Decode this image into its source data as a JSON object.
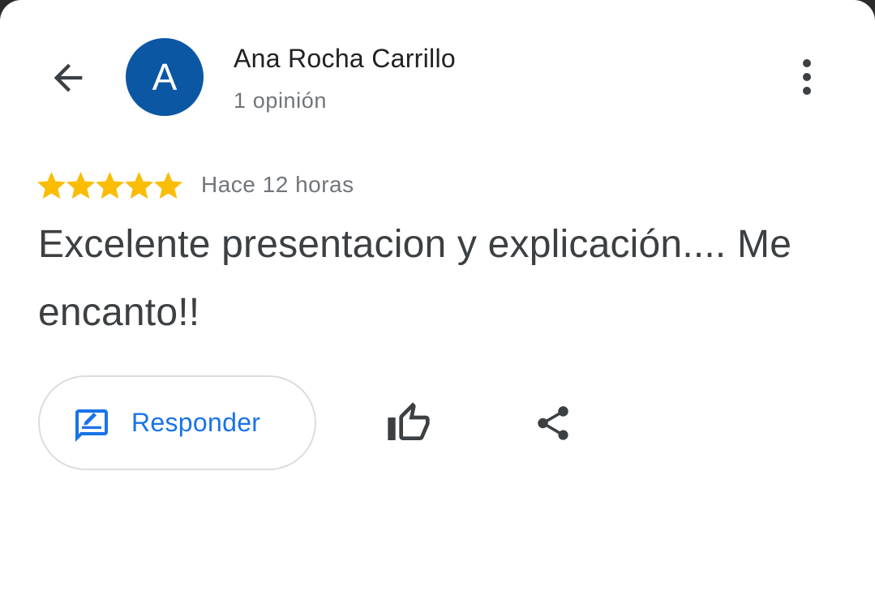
{
  "header": {
    "avatar_letter": "A",
    "avatar_color": "#0b57a4",
    "author_name": "Ana Rocha Carrillo",
    "review_count": "1 opinión",
    "back_icon": "arrow-back-icon",
    "more_icon": "more-vert-icon"
  },
  "review": {
    "rating": 5,
    "rating_max": 5,
    "star_color": "#fbbc04",
    "time": "Hace 12 horas",
    "text": "Excelente presentacion y explicación.... Me encanto!!"
  },
  "actions": {
    "reply_label": "Responder",
    "reply_icon": "reply-feedback-icon",
    "like_icon": "thumb-up-icon",
    "share_icon": "share-icon",
    "accent_color": "#1a73e8"
  }
}
